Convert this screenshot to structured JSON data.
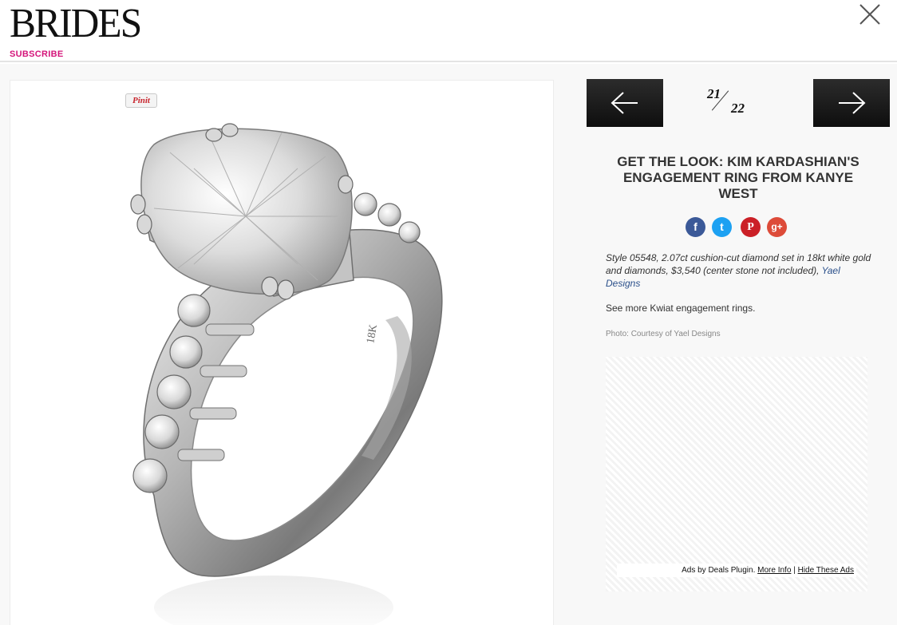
{
  "header": {
    "logo": "BRIDES",
    "subscribe_label": "SUBSCRIBE"
  },
  "gallery": {
    "pin_label": "Pinit",
    "current": "21",
    "total": "22"
  },
  "article": {
    "title": "GET THE LOOK: KIM KARDASHIAN'S ENGAGEMENT RING FROM KANYE WEST",
    "description_text": "Style 05548, 2.07ct cushion-cut diamond set in 18kt white gold and diamonds, $3,540 (center stone not included), ",
    "description_link": "Yael Designs",
    "see_more": "See more Kwiat engagement rings.",
    "photo_credit": "Photo: Courtesy of Yael Designs"
  },
  "social": {
    "facebook": "f",
    "twitter": "t",
    "pinterest": "P",
    "googleplus": "g+"
  },
  "ads": {
    "label": "Ads by Deals Plugin.",
    "more_info": "More Info",
    "separator": "|",
    "hide": "Hide These Ads"
  },
  "colors": {
    "subscribe": "#d4147a",
    "facebook": "#3b5998",
    "twitter": "#1da1f2",
    "pinterest": "#cb2027",
    "googleplus": "#dd4b39"
  }
}
